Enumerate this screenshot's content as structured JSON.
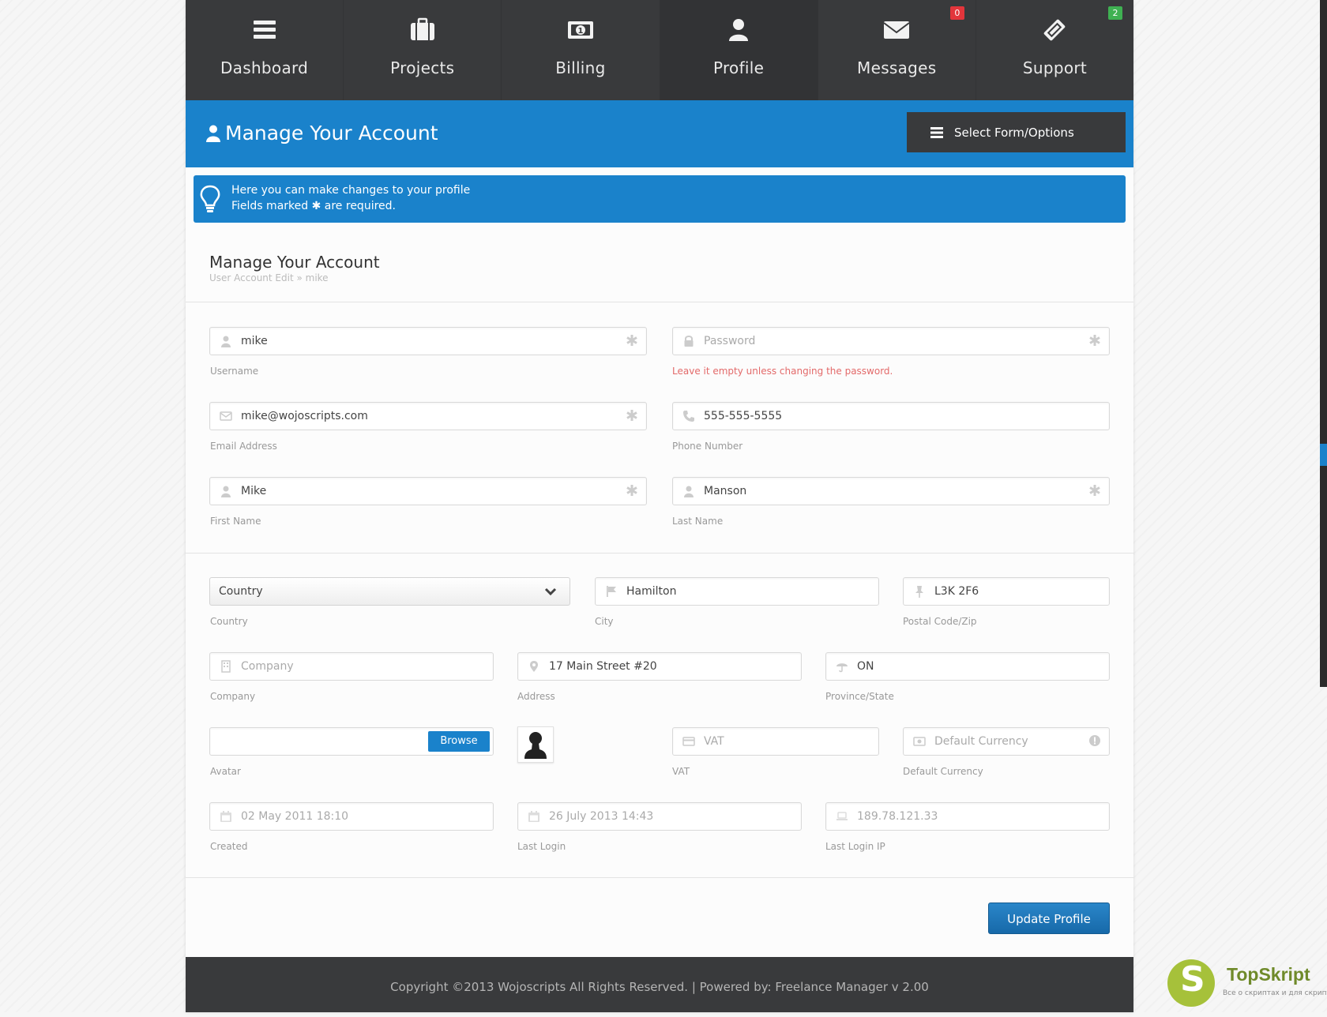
{
  "nav": {
    "items": [
      {
        "label": "Dashboard",
        "icon": "menu-icon"
      },
      {
        "label": "Projects",
        "icon": "briefcase-icon"
      },
      {
        "label": "Billing",
        "icon": "money-icon"
      },
      {
        "label": "Profile",
        "icon": "user-icon",
        "active": true
      },
      {
        "label": "Messages",
        "icon": "envelope-icon",
        "badge": "0"
      },
      {
        "label": "Support",
        "icon": "ticket-icon",
        "badge": "2"
      }
    ]
  },
  "header": {
    "title": "Manage Your Account",
    "select_button": "Select Form/Options"
  },
  "info": {
    "line1": "Here you can make changes to your profile",
    "line2_prefix": "Fields marked",
    "line2_suffix": "are required."
  },
  "panel": {
    "title": "Manage Your Account",
    "subtitle": "User Account Edit » mike"
  },
  "fields": {
    "username": {
      "value": "mike",
      "label": "Username"
    },
    "password": {
      "placeholder": "Password",
      "label": "Leave it empty unless changing the password."
    },
    "email": {
      "value": "mike@wojoscripts.com",
      "label": "Email Address"
    },
    "phone": {
      "value": "555-555-5555",
      "label": "Phone Number"
    },
    "first_name": {
      "value": "Mike",
      "label": "First Name"
    },
    "last_name": {
      "value": "Manson",
      "label": "Last Name"
    },
    "country": {
      "value": "Country",
      "label": "Country"
    },
    "city": {
      "value": "Hamilton",
      "label": "City"
    },
    "postal": {
      "value": "L3K 2F6",
      "label": "Postal Code/Zip"
    },
    "company": {
      "placeholder": "Company",
      "label": "Company"
    },
    "address": {
      "value": "17 Main Street #20",
      "label": "Address"
    },
    "province": {
      "value": "ON",
      "label": "Province/State"
    },
    "avatar": {
      "button": "Browse",
      "label": "Avatar"
    },
    "vat": {
      "placeholder": "VAT",
      "label": "VAT"
    },
    "currency": {
      "placeholder": "Default Currency",
      "label": "Default Currency"
    },
    "created": {
      "value": "02 May 2011 18:10",
      "label": "Created"
    },
    "last_login": {
      "value": "26 July 2013 14:43",
      "label": "Last Login"
    },
    "last_ip": {
      "value": "189.78.121.33",
      "label": "Last Login IP"
    }
  },
  "actions": {
    "update": "Update Profile"
  },
  "footer": {
    "text": "Copyright ©2013 Wojoscripts All Rights Reserved. | Powered by: Freelance Manager v 2.00"
  },
  "watermark": {
    "title": "TopSkript",
    "tagline": "Все о скриптах и для скриптов..."
  },
  "colors": {
    "accent": "#1a82cb",
    "nav_bg": "#393a3c",
    "badge_red": "#e2353b",
    "badge_green": "#3fb152"
  }
}
